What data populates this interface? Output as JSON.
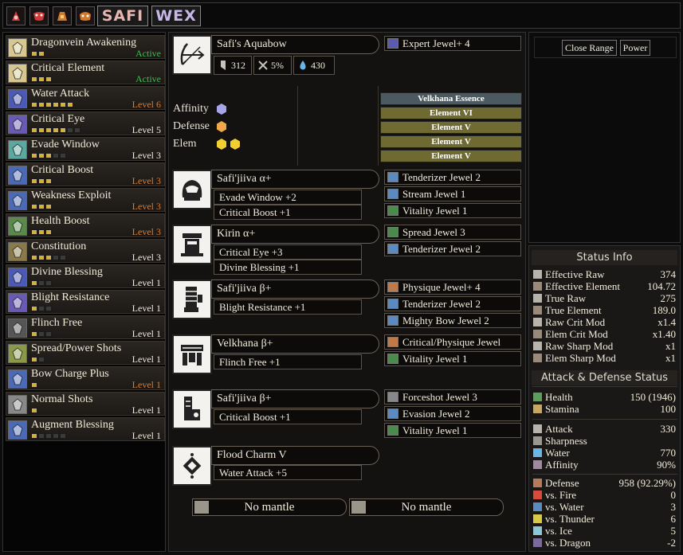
{
  "topbar": {
    "icons": [
      "armor-set-icon-1",
      "armor-set-icon-2",
      "armor-set-icon-3",
      "armor-set-icon-4"
    ],
    "set_buttons": [
      "SAFI",
      "WEX"
    ]
  },
  "skills": [
    {
      "name": "Dragonvein Awakening",
      "level": "Active",
      "pips": 2,
      "max": 2,
      "color": "active"
    },
    {
      "name": "Critical Element",
      "level": "Active",
      "pips": 3,
      "max": 3,
      "color": "active"
    },
    {
      "name": "Water Attack",
      "level": "Level 6",
      "pips": 6,
      "max": 6,
      "color": "orange"
    },
    {
      "name": "Critical Eye",
      "level": "Level 5",
      "pips": 5,
      "max": 7,
      "color": "normal"
    },
    {
      "name": "Evade Window",
      "level": "Level 3",
      "pips": 3,
      "max": 5,
      "color": "normal"
    },
    {
      "name": "Critical Boost",
      "level": "Level 3",
      "pips": 3,
      "max": 3,
      "color": "orange"
    },
    {
      "name": "Weakness Exploit",
      "level": "Level 3",
      "pips": 3,
      "max": 3,
      "color": "orange"
    },
    {
      "name": "Health Boost",
      "level": "Level 3",
      "pips": 3,
      "max": 3,
      "color": "orange"
    },
    {
      "name": "Constitution",
      "level": "Level 3",
      "pips": 3,
      "max": 5,
      "color": "normal"
    },
    {
      "name": "Divine Blessing",
      "level": "Level 1",
      "pips": 1,
      "max": 3,
      "color": "normal"
    },
    {
      "name": "Blight Resistance",
      "level": "Level 1",
      "pips": 1,
      "max": 3,
      "color": "normal"
    },
    {
      "name": "Flinch Free",
      "level": "Level 1",
      "pips": 1,
      "max": 3,
      "color": "normal"
    },
    {
      "name": "Spread/Power Shots",
      "level": "Level 1",
      "pips": 1,
      "max": 2,
      "color": "normal"
    },
    {
      "name": "Bow Charge Plus",
      "level": "Level 1",
      "pips": 1,
      "max": 1,
      "color": "orange"
    },
    {
      "name": "Normal Shots",
      "level": "Level 1",
      "pips": 1,
      "max": 1,
      "color": "normal"
    },
    {
      "name": "Augment Blessing",
      "level": "Level 1",
      "pips": 1,
      "max": 5,
      "color": "normal"
    }
  ],
  "weapon": {
    "name": "Safi's Aquabow",
    "attack": "312",
    "affinity": "5%",
    "element": "430",
    "jewel": "Expert Jewel+ 4",
    "labels": {
      "affinity": "Affinity",
      "defense": "Defense",
      "elem": "Elem"
    },
    "augments": [
      "Velkhana Essence",
      "Element VI",
      "Element V",
      "Element V",
      "Element V"
    ]
  },
  "armor": [
    {
      "name": "Safi'jiiva α+",
      "skills": [
        "Evade Window +2",
        "Critical Boost +1"
      ],
      "jewels": [
        "Tenderizer Jewel 2",
        "Stream Jewel 1",
        "Vitality Jewel 1"
      ]
    },
    {
      "name": "Kirin α+",
      "skills": [
        "Critical Eye +3",
        "Divine Blessing +1"
      ],
      "jewels": [
        "Spread Jewel 3",
        "Tenderizer Jewel 2"
      ]
    },
    {
      "name": "Safi'jiiva β+",
      "skills": [
        "Blight Resistance +1"
      ],
      "jewels": [
        "Physique Jewel+ 4",
        "Tenderizer Jewel 2",
        "Mighty Bow Jewel 2"
      ]
    },
    {
      "name": "Velkhana β+",
      "skills": [
        "Flinch Free +1"
      ],
      "jewels": [
        "Critical/Physique Jewel",
        "Vitality Jewel 1"
      ]
    },
    {
      "name": "Safi'jiiva β+",
      "skills": [
        "Critical Boost +1"
      ],
      "jewels": [
        "Forceshot Jewel 3",
        "Evasion Jewel 2",
        "Vitality Jewel 1"
      ]
    }
  ],
  "charm": {
    "name": "Flood Charm V",
    "skill": "Water Attack +5"
  },
  "mantles": [
    "No mantle",
    "No mantle"
  ],
  "range_buttons": [
    "Close Range",
    "Power"
  ],
  "status": {
    "title": "Status Info",
    "rows": [
      {
        "label": "Effective Raw",
        "value": "374"
      },
      {
        "label": "Effective Element",
        "value": "104.72"
      },
      {
        "label": "True Raw",
        "value": "275"
      },
      {
        "label": "True Element",
        "value": "189.0"
      },
      {
        "label": "Raw Crit Mod",
        "value": "x1.4"
      },
      {
        "label": "Elem Crit Mod",
        "value": "x1.40"
      },
      {
        "label": "Raw Sharp Mod",
        "value": "x1"
      },
      {
        "label": "Elem Sharp Mod",
        "value": "x1"
      }
    ]
  },
  "attack_defense": {
    "title": "Attack & Defense Status",
    "vitals": [
      {
        "label": "Health",
        "value": "150 (1946)"
      },
      {
        "label": "Stamina",
        "value": "100"
      }
    ],
    "offense": [
      {
        "label": "Attack",
        "value": "330"
      },
      {
        "label": "Sharpness",
        "value": ""
      },
      {
        "label": "Water",
        "value": "770"
      },
      {
        "label": "Affinity",
        "value": "90%"
      }
    ],
    "defense": [
      {
        "label": "Defense",
        "value": "958 (92.29%)"
      },
      {
        "label": "vs. Fire",
        "value": "0"
      },
      {
        "label": "vs. Water",
        "value": "3"
      },
      {
        "label": "vs. Thunder",
        "value": "6"
      },
      {
        "label": "vs. Ice",
        "value": "5"
      },
      {
        "label": "vs. Dragon",
        "value": "-2"
      }
    ]
  }
}
